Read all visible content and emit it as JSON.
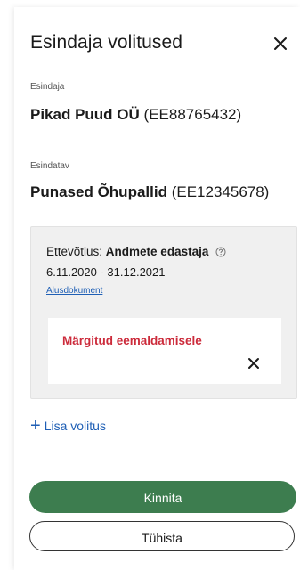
{
  "modal": {
    "title": "Esindaja volitused",
    "close_icon": "close-icon"
  },
  "representative": {
    "label": "Esindaja",
    "name": "Pikad Puud OÜ",
    "code": "(EE88765432)"
  },
  "represented": {
    "label": "Esindatav",
    "name": "Punased Õhupallid",
    "code": "(EE12345678)"
  },
  "mandate": {
    "type_label": "Ettevõtlus:",
    "role": "Andmete edastaja",
    "help_icon": "help-circle-icon",
    "period": "6.11.2020 - 31.12.2021",
    "document_link": "Alusdokument",
    "removal_notice": "Märgitud eemaldamisele",
    "remove_icon": "close-icon"
  },
  "add_mandate": {
    "icon": "plus-icon",
    "label": "Lisa volitus"
  },
  "buttons": {
    "confirm": "Kinnita",
    "cancel": "Tühista"
  },
  "colors": {
    "primary": "#3d7d4f",
    "link": "#1f5fb5",
    "danger": "#cc2b3b",
    "card_bg": "#f0f0f0"
  }
}
